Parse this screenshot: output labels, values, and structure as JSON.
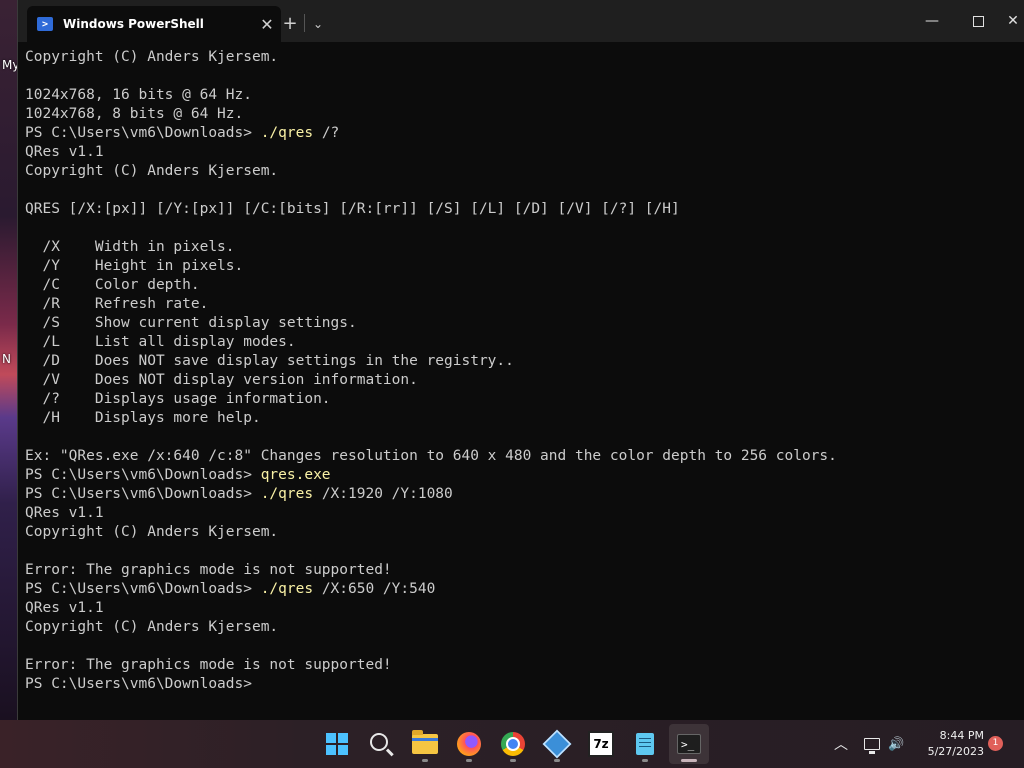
{
  "desktop": {
    "labels": [
      "My",
      "N"
    ]
  },
  "window": {
    "tab_title": "Windows PowerShell",
    "tab_close": "✕",
    "new_tab": "+",
    "dropdown": "⌄",
    "minimize": "—",
    "close": "✕"
  },
  "terminal": {
    "lines": [
      {
        "text": "Copyright (C) Anders Kjersem."
      },
      {
        "text": ""
      },
      {
        "text": "1024x768, 16 bits @ 64 Hz."
      },
      {
        "text": "1024x768, 8 bits @ 64 Hz."
      },
      {
        "prompt": "PS C:\\Users\\vm6\\Downloads> ",
        "cmd": "./qres",
        "args": " /?"
      },
      {
        "text": "QRes v1.1"
      },
      {
        "text": "Copyright (C) Anders Kjersem."
      },
      {
        "text": ""
      },
      {
        "text": "QRES [/X:[px]] [/Y:[px]] [/C:[bits] [/R:[rr]] [/S] [/L] [/D] [/V] [/?] [/H]"
      },
      {
        "text": ""
      },
      {
        "text": "  /X    Width in pixels."
      },
      {
        "text": "  /Y    Height in pixels."
      },
      {
        "text": "  /C    Color depth."
      },
      {
        "text": "  /R    Refresh rate."
      },
      {
        "text": "  /S    Show current display settings."
      },
      {
        "text": "  /L    List all display modes."
      },
      {
        "text": "  /D    Does NOT save display settings in the registry.."
      },
      {
        "text": "  /V    Does NOT display version information."
      },
      {
        "text": "  /?    Displays usage information."
      },
      {
        "text": "  /H    Displays more help."
      },
      {
        "text": ""
      },
      {
        "text": "Ex: \"QRes.exe /x:640 /c:8\" Changes resolution to 640 x 480 and the color depth to 256 colors."
      },
      {
        "prompt": "PS C:\\Users\\vm6\\Downloads> ",
        "cmd": "qres.exe",
        "args": ""
      },
      {
        "prompt": "PS C:\\Users\\vm6\\Downloads> ",
        "cmd": "./qres",
        "args": " /X:1920 /Y:1080"
      },
      {
        "text": "QRes v1.1"
      },
      {
        "text": "Copyright (C) Anders Kjersem."
      },
      {
        "text": ""
      },
      {
        "text": "Error: The graphics mode is not supported!"
      },
      {
        "prompt": "PS C:\\Users\\vm6\\Downloads> ",
        "cmd": "./qres",
        "args": " /X:650 /Y:540"
      },
      {
        "text": "QRes v1.1"
      },
      {
        "text": "Copyright (C) Anders Kjersem."
      },
      {
        "text": ""
      },
      {
        "text": "Error: The graphics mode is not supported!"
      },
      {
        "prompt": "PS C:\\Users\\vm6\\Downloads> ",
        "cmd": "",
        "args": ""
      }
    ],
    "command_color": "#f9f1a5",
    "text_color": "#cccccc",
    "background": "#0c0c0c"
  },
  "taskbar": {
    "apps": [
      {
        "name": "start-button",
        "icon": "windows-logo-icon",
        "active": false
      },
      {
        "name": "search-button",
        "icon": "search-icon",
        "active": false
      },
      {
        "name": "file-explorer-button",
        "icon": "folder-icon",
        "active": false
      },
      {
        "name": "firefox-button",
        "icon": "firefox-icon",
        "active": false
      },
      {
        "name": "chrome-button",
        "icon": "chrome-icon",
        "active": false
      },
      {
        "name": "app-cube-button",
        "icon": "cube-icon",
        "active": false
      },
      {
        "name": "7zip-button",
        "icon": "7zip-icon",
        "active": false
      },
      {
        "name": "notepad-button",
        "icon": "notepad-icon",
        "active": false
      },
      {
        "name": "terminal-button",
        "icon": "terminal-icon",
        "active": true
      }
    ],
    "sevenzip_label": "7z",
    "terminal_label": ">_",
    "tray_chevron": "︿",
    "volume": "🔊",
    "time": "8:44 PM",
    "date": "5/27/2023",
    "notification_count": "1"
  }
}
